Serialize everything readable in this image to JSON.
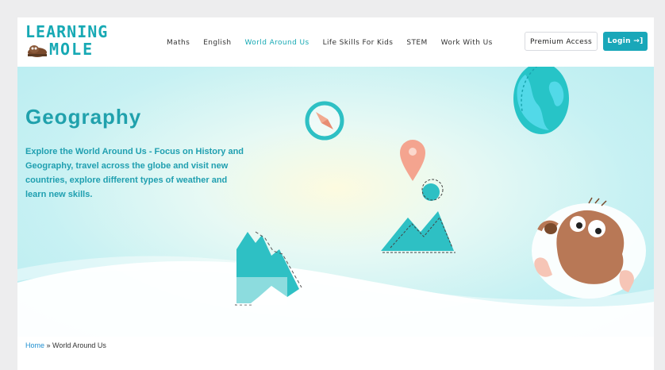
{
  "logo": {
    "line1": "LEARNING",
    "line2": "MOLE"
  },
  "nav": {
    "items": [
      {
        "label": "Maths"
      },
      {
        "label": "English"
      },
      {
        "label": "World Around Us"
      },
      {
        "label": "Life Skills For Kids"
      },
      {
        "label": "STEM"
      },
      {
        "label": "Work With Us"
      }
    ],
    "active": "World Around Us"
  },
  "header": {
    "premium_label": "Premium Access",
    "login_label": "Login →]"
  },
  "hero": {
    "title": "Geography",
    "text": "Explore the World Around Us - Focus on History and Geography, travel across the globe and visit new countries, explore different types of weather and learn new skills."
  },
  "breadcrumb": {
    "home": "Home",
    "separator": " » ",
    "current": "World Around Us"
  },
  "colors": {
    "brand": "#17a9b4",
    "accent_button": "#19a7b9",
    "link": "#1f8fd0"
  },
  "icons": [
    "mole-logo-icon",
    "compass-icon",
    "map-pin-icon",
    "globe-icon",
    "picture-icon",
    "mountain-icon",
    "mole-mascot-icon",
    "login-arrow-icon"
  ]
}
